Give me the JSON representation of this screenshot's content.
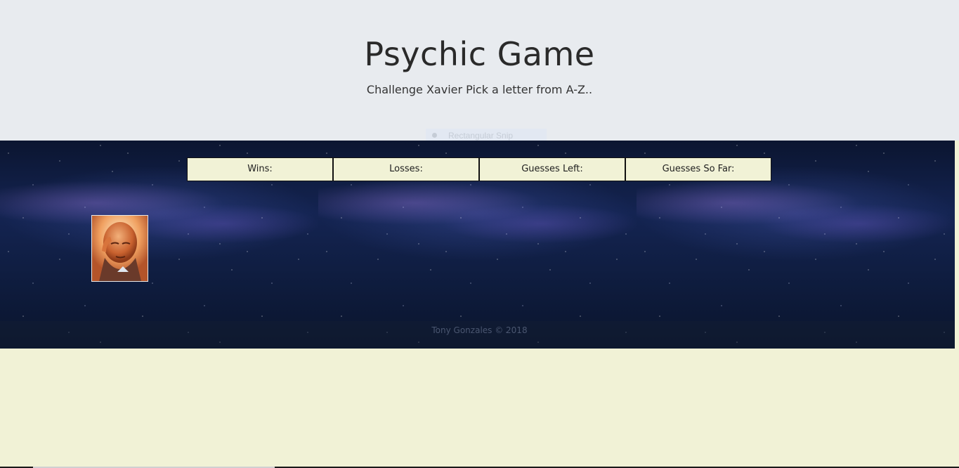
{
  "header": {
    "title": "Psychic Game",
    "subtitle": "Challenge Xavier Pick a letter from A-Z.."
  },
  "overlay": {
    "snip_label": "Rectangular Snip"
  },
  "scoreboard": {
    "cells": [
      {
        "label": "Wins:"
      },
      {
        "label": "Losses:"
      },
      {
        "label": "Guesses Left:"
      },
      {
        "label": "Guesses So Far:"
      }
    ]
  },
  "footer": {
    "text": "Tony Gonzales © 2018"
  },
  "colors": {
    "header_bg": "#e8ebef",
    "page_bg": "#f1f2d6",
    "cell_bg": "#f1f2d6",
    "galaxy_dark": "#0b1530"
  },
  "icons": {
    "avatar": "professor-x-portrait",
    "snip": "snip-dot-icon"
  }
}
